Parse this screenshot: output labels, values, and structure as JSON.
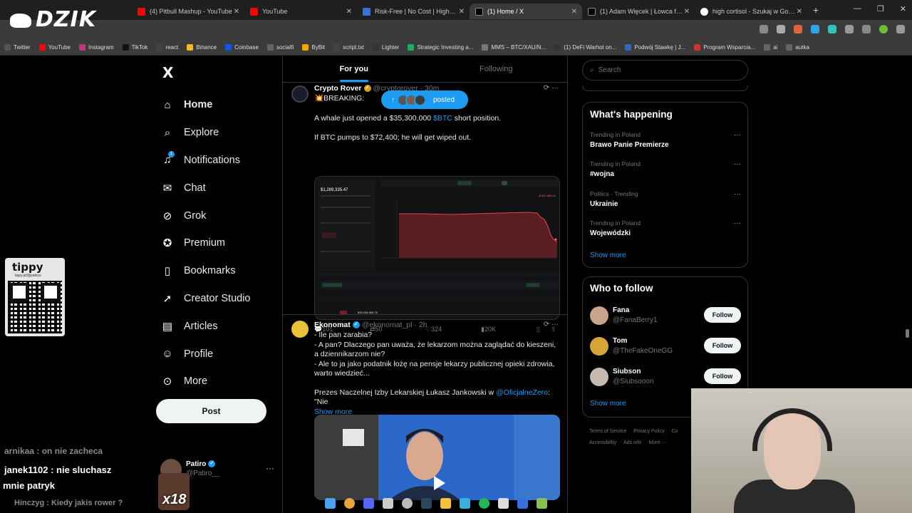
{
  "browser": {
    "tabs": [
      {
        "title": "(4) Pitbull Mashup - YouTube",
        "icon": "youtube-icon",
        "active": false
      },
      {
        "title": "YouTube",
        "icon": "youtube-icon",
        "active": false
      },
      {
        "title": "Risk-Free | No Cost | High Re...",
        "icon": "x-icon",
        "active": false
      },
      {
        "title": "(1) Home / X",
        "icon": "x-icon",
        "active": true
      },
      {
        "title": "(1) Adam Więcek | Łowca fu...",
        "icon": "x-icon",
        "active": false
      },
      {
        "title": "high cortisol - Szukaj w Google",
        "icon": "google-icon",
        "active": false
      }
    ],
    "bookmarks": [
      "Twitter",
      "YouTube",
      "Instagram",
      "TikTok",
      "react",
      "Binance",
      "Coinbase",
      "socialfi",
      "ByBit",
      "script.txt",
      "Lighter",
      "Strategic Investing a...",
      "MMS – BTC/XAU/N...",
      "(1) DeFi Warhol on...",
      "Podwój Stawkę | J...",
      "Program Wsparcia...",
      "ai",
      "autka"
    ]
  },
  "overlay": {
    "logo": "DZIK",
    "tippy_title": "tippy",
    "tippy_url": "tippy.pl/@patiryo",
    "emote_count": "x18",
    "chat": [
      {
        "user": "arnikaa",
        "msg": "on nie zacheca",
        "color": "#8a8a8a"
      },
      {
        "user": "janek1102",
        "msg": "nie sluchasz",
        "color": "#ffffff"
      },
      {
        "user": "",
        "msg": "mnie patryk",
        "color": "#ffffff"
      },
      {
        "user": "Hinczyg",
        "msg": "Kiedy jakis rower ?",
        "color": "#8a8a8a"
      }
    ]
  },
  "sidebar": {
    "logo": "X",
    "items": [
      {
        "label": "Home",
        "icon": "home-icon"
      },
      {
        "label": "Explore",
        "icon": "search-icon"
      },
      {
        "label": "Notifications",
        "icon": "bell-icon",
        "badge": "1"
      },
      {
        "label": "Chat",
        "icon": "mail-icon"
      },
      {
        "label": "Grok",
        "icon": "grok-icon"
      },
      {
        "label": "Premium",
        "icon": "premium-icon"
      },
      {
        "label": "Bookmarks",
        "icon": "bookmark-icon"
      },
      {
        "label": "Creator Studio",
        "icon": "rocket-icon"
      },
      {
        "label": "Articles",
        "icon": "article-icon"
      },
      {
        "label": "Profile",
        "icon": "person-icon"
      },
      {
        "label": "More",
        "icon": "more-icon"
      }
    ],
    "post_label": "Post",
    "account": {
      "name": "Patiro",
      "handle": "@Patiro__"
    }
  },
  "feed": {
    "tabs": [
      "For you",
      "Following"
    ],
    "posted_pill": "posted",
    "tweets": [
      {
        "name": "Crypto Rover",
        "handle": "@cryptorover · 30m",
        "lines": [
          "💥BREAKING:",
          "",
          "A whale just opened a $35,300,000 $BTC short position.",
          "",
          "If BTC pumps to $72,400; he will get wiped out."
        ],
        "cashtag": "$BTC",
        "stats": {
          "replies": "101",
          "reposts": "50",
          "likes": "324",
          "views": "20K"
        }
      },
      {
        "name": "Ekonomat",
        "handle": "@ekonomat_pl · 2h",
        "lines": [
          "- Ile pan zarabia?",
          "- A pan? Dlaczego pan uważa, że lekarzom można zaglądać do kieszeni, a dziennikarzom nie?",
          "- Ale to ja jako podatnik łożę na pensje lekarzy publicznej opieki zdrowia, warto wiedzieć...",
          "",
          "Prezes Naczelnej Izby Lekarskiej Łukasz Jankowski w @OficjalneZero: \"Nie"
        ],
        "mention": "@OficjalneZero",
        "show_more": "Show more"
      }
    ],
    "chart_card": {
      "top_value": "$1,289,335.47",
      "pnl": "-$ 962,980.32",
      "footer": "$35,038,965.76"
    }
  },
  "right": {
    "search_placeholder": "Search",
    "happening_title": "What's happening",
    "trends": [
      {
        "context": "Trending in Poland",
        "name": "Brawo Panie Premierze"
      },
      {
        "context": "Trending in Poland",
        "name": "#wojna"
      },
      {
        "context": "Politics · Trending",
        "name": "Ukrainie"
      },
      {
        "context": "Trending in Poland",
        "name": "Wojewódzki"
      }
    ],
    "show_more": "Show more",
    "who_title": "Who to follow",
    "follow": [
      {
        "name": "Fana",
        "handle": "@FanaBerry1"
      },
      {
        "name": "Tom",
        "handle": "@TheFakeOneGG"
      },
      {
        "name": "Siubson",
        "handle": "@Siubsooon"
      }
    ],
    "follow_label": "Follow",
    "footer": [
      "Terms of Service",
      "Privacy Policy",
      "Co",
      "Accessibility",
      "Ads info",
      "More ···"
    ]
  }
}
